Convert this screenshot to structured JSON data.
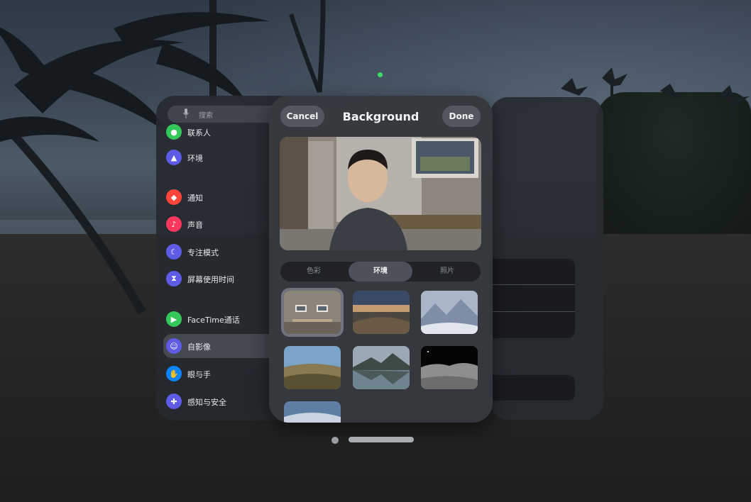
{
  "colors": {
    "accent_green": "#3ddc68",
    "panel_bg": "#36393e",
    "button_bg": "#565a60"
  },
  "background_panel": {
    "title": "Background",
    "cancel_label": "Cancel",
    "done_label": "Done",
    "segments": [
      {
        "label": "色彩",
        "selected": false
      },
      {
        "label": "环境",
        "selected": true
      },
      {
        "label": "照片",
        "selected": false
      }
    ],
    "environments": [
      {
        "icon": "gallery-room-thumb",
        "selected": true
      },
      {
        "icon": "sunset-clouds-thumb",
        "selected": false
      },
      {
        "icon": "snow-mountain-thumb",
        "selected": false
      },
      {
        "icon": "meadow-thumb",
        "selected": false
      },
      {
        "icon": "lake-mountain-thumb",
        "selected": false
      },
      {
        "icon": "moon-surface-thumb",
        "selected": false
      },
      {
        "icon": "sky-clouds-thumb",
        "selected": false
      }
    ]
  },
  "settings_sidebar": {
    "search_placeholder": "搜索",
    "items": [
      {
        "label": "联系人",
        "icon": "contacts-icon",
        "color": "#34c759"
      },
      {
        "label": "环境",
        "icon": "environment-icon",
        "color": "#5e5ce6"
      },
      {
        "label": "通知",
        "icon": "notifications-icon",
        "color": "#ff453a"
      },
      {
        "label": "声音",
        "icon": "sound-icon",
        "color": "#ff375f"
      },
      {
        "label": "专注模式",
        "icon": "focus-moon-icon",
        "color": "#5e5ce6"
      },
      {
        "label": "屏幕使用时间",
        "icon": "hourglass-icon",
        "color": "#5e5ce6"
      },
      {
        "label": "FaceTime通话",
        "icon": "facetime-icon",
        "color": "#34c759"
      },
      {
        "label": "自影像",
        "icon": "persona-icon",
        "color": "#5e5ce6",
        "selected": true
      },
      {
        "label": "眼与手",
        "icon": "hand-icon",
        "color": "#0a84ff"
      },
      {
        "label": "感知与安全",
        "icon": "safety-icon",
        "color": "#5e5ce6"
      }
    ]
  }
}
